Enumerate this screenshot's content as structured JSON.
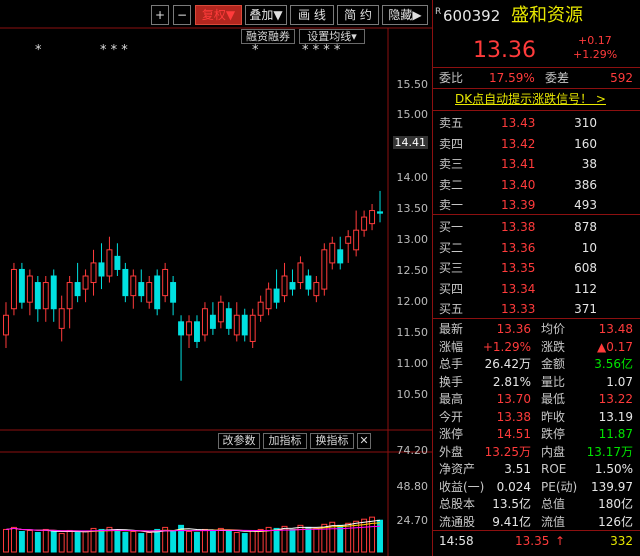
{
  "toolbar": {
    "plus": "+",
    "minus": "−",
    "fuquan": "复权▼",
    "diejia": "叠加▼",
    "huaxian": "画 线",
    "jianyue": "简 约",
    "yincang": "隐藏▶"
  },
  "chart_tags": {
    "rzrq": "融资融券",
    "ma": "设置均线▾"
  },
  "price_axis": [
    "15.50",
    "15.00",
    "14.41",
    "14.00",
    "13.50",
    "13.00",
    "12.50",
    "12.00",
    "11.50",
    "11.00",
    "10.50"
  ],
  "indicator_bar": {
    "params": "改参数",
    "add": "加指标",
    "swap": "换指标",
    "close": "✕"
  },
  "vol_axis": [
    "74.20",
    "48.80",
    "24.70"
  ],
  "stars": [
    "*",
    "* * *",
    "*",
    "* * * *"
  ],
  "stock": {
    "code": "600392",
    "name": "盛和资源",
    "price": "13.36",
    "change": "+0.17",
    "pct": "+1.29%"
  },
  "weibi": {
    "label": "委比",
    "value": "17.59%",
    "wc_label": "委差",
    "wc_value": "592"
  },
  "banner": "DK点自动提示涨跌信号！ >",
  "asks": [
    {
      "label": "卖五",
      "price": "13.43",
      "vol": "310"
    },
    {
      "label": "卖四",
      "price": "13.42",
      "vol": "160"
    },
    {
      "label": "卖三",
      "price": "13.41",
      "vol": "38"
    },
    {
      "label": "卖二",
      "price": "13.40",
      "vol": "386"
    },
    {
      "label": "卖一",
      "price": "13.39",
      "vol": "493"
    }
  ],
  "bids": [
    {
      "label": "买一",
      "price": "13.38",
      "vol": "878"
    },
    {
      "label": "买二",
      "price": "13.36",
      "vol": "10"
    },
    {
      "label": "买三",
      "price": "13.35",
      "vol": "608"
    },
    {
      "label": "买四",
      "price": "13.34",
      "vol": "112"
    },
    {
      "label": "买五",
      "price": "13.33",
      "vol": "371"
    }
  ],
  "quote": [
    {
      "l1": "最新",
      "v1": "13.36",
      "c1": "red",
      "l2": "均价",
      "v2": "13.48",
      "c2": "red"
    },
    {
      "l1": "涨幅",
      "v1": "+1.29%",
      "c1": "red",
      "l2": "涨跌",
      "v2": "▲0.17",
      "c2": "red"
    },
    {
      "l1": "总手",
      "v1": "26.42万",
      "c1": "white",
      "l2": "金额",
      "v2": "3.56亿",
      "c2": "green"
    },
    {
      "l1": "换手",
      "v1": "2.81%",
      "c1": "white",
      "l2": "量比",
      "v2": "1.07",
      "c2": "white"
    },
    {
      "l1": "最高",
      "v1": "13.70",
      "c1": "red",
      "l2": "最低",
      "v2": "13.22",
      "c2": "red"
    },
    {
      "l1": "今开",
      "v1": "13.38",
      "c1": "red",
      "l2": "昨收",
      "v2": "13.19",
      "c2": "white"
    },
    {
      "l1": "涨停",
      "v1": "14.51",
      "c1": "red",
      "l2": "跌停",
      "v2": "11.87",
      "c2": "green"
    },
    {
      "l1": "外盘",
      "v1": "13.25万",
      "c1": "red",
      "l2": "内盘",
      "v2": "13.17万",
      "c2": "green"
    },
    {
      "l1": "净资产",
      "v1": "3.51",
      "c1": "white",
      "l2": "ROE",
      "v2": "1.50%",
      "c2": "white"
    },
    {
      "l1": "收益(一)",
      "v1": "0.024",
      "c1": "white",
      "l2": "PE(动)",
      "v2": "139.97",
      "c2": "white"
    },
    {
      "l1": "总股本",
      "v1": "13.5亿",
      "c1": "white",
      "l2": "总值",
      "v2": "180亿",
      "c2": "white"
    },
    {
      "l1": "流通股",
      "v1": "9.41亿",
      "c1": "white",
      "l2": "流值",
      "v2": "126亿",
      "c2": "white"
    }
  ],
  "tick": {
    "time": "14:58",
    "price": "13.35",
    "arrow": "↑",
    "vol": "332"
  },
  "colors": {
    "up": "#ff3b3b",
    "down": "#00e0e0",
    "ma5": "#ffffff",
    "ma10": "#ffd400",
    "ma20": "#ff00ff",
    "grid": "#8c1010"
  },
  "chart_data": {
    "type": "candlestick",
    "ylim": [
      10.2,
      15.7
    ],
    "candles": [
      {
        "o": 11.5,
        "c": 11.8,
        "h": 12.0,
        "l": 11.3
      },
      {
        "o": 11.9,
        "c": 12.5,
        "h": 12.6,
        "l": 11.8
      },
      {
        "o": 12.5,
        "c": 12.0,
        "h": 12.6,
        "l": 11.9
      },
      {
        "o": 12.0,
        "c": 12.4,
        "h": 12.5,
        "l": 11.8
      },
      {
        "o": 12.3,
        "c": 11.9,
        "h": 12.4,
        "l": 11.7
      },
      {
        "o": 11.9,
        "c": 12.3,
        "h": 12.4,
        "l": 11.7
      },
      {
        "o": 12.4,
        "c": 11.9,
        "h": 12.5,
        "l": 11.7
      },
      {
        "o": 11.6,
        "c": 11.9,
        "h": 12.1,
        "l": 11.4
      },
      {
        "o": 11.9,
        "c": 12.3,
        "h": 12.4,
        "l": 11.6
      },
      {
        "o": 12.3,
        "c": 12.1,
        "h": 12.6,
        "l": 12.0
      },
      {
        "o": 12.2,
        "c": 12.4,
        "h": 12.5,
        "l": 12.0
      },
      {
        "o": 12.3,
        "c": 12.6,
        "h": 12.8,
        "l": 12.1
      },
      {
        "o": 12.6,
        "c": 12.4,
        "h": 12.9,
        "l": 12.2
      },
      {
        "o": 12.4,
        "c": 12.8,
        "h": 13.0,
        "l": 12.3
      },
      {
        "o": 12.7,
        "c": 12.5,
        "h": 12.9,
        "l": 12.4
      },
      {
        "o": 12.5,
        "c": 12.1,
        "h": 12.6,
        "l": 12.0
      },
      {
        "o": 12.1,
        "c": 12.4,
        "h": 12.5,
        "l": 11.9
      },
      {
        "o": 12.3,
        "c": 12.1,
        "h": 12.5,
        "l": 12.0
      },
      {
        "o": 12.0,
        "c": 12.3,
        "h": 12.4,
        "l": 11.9
      },
      {
        "o": 12.4,
        "c": 11.9,
        "h": 12.5,
        "l": 11.8
      },
      {
        "o": 12.1,
        "c": 12.5,
        "h": 12.6,
        "l": 12.0
      },
      {
        "o": 12.3,
        "c": 12.0,
        "h": 12.4,
        "l": 11.8
      },
      {
        "o": 11.7,
        "c": 11.5,
        "h": 11.8,
        "l": 10.8
      },
      {
        "o": 11.5,
        "c": 11.7,
        "h": 11.8,
        "l": 11.3
      },
      {
        "o": 11.7,
        "c": 11.4,
        "h": 11.8,
        "l": 11.3
      },
      {
        "o": 11.5,
        "c": 11.9,
        "h": 12.0,
        "l": 11.4
      },
      {
        "o": 11.8,
        "c": 11.6,
        "h": 12.0,
        "l": 11.5
      },
      {
        "o": 11.7,
        "c": 12.0,
        "h": 12.1,
        "l": 11.6
      },
      {
        "o": 11.9,
        "c": 11.6,
        "h": 12.0,
        "l": 11.5
      },
      {
        "o": 11.5,
        "c": 11.8,
        "h": 12.0,
        "l": 11.4
      },
      {
        "o": 11.8,
        "c": 11.5,
        "h": 11.9,
        "l": 11.4
      },
      {
        "o": 11.4,
        "c": 11.8,
        "h": 11.9,
        "l": 11.3
      },
      {
        "o": 11.8,
        "c": 12.0,
        "h": 12.1,
        "l": 11.7
      },
      {
        "o": 11.9,
        "c": 12.2,
        "h": 12.3,
        "l": 11.8
      },
      {
        "o": 12.2,
        "c": 12.0,
        "h": 12.5,
        "l": 11.9
      },
      {
        "o": 12.1,
        "c": 12.4,
        "h": 12.6,
        "l": 12.0
      },
      {
        "o": 12.3,
        "c": 12.2,
        "h": 12.5,
        "l": 12.1
      },
      {
        "o": 12.3,
        "c": 12.6,
        "h": 12.7,
        "l": 12.2
      },
      {
        "o": 12.4,
        "c": 12.2,
        "h": 12.5,
        "l": 12.1
      },
      {
        "o": 12.1,
        "c": 12.3,
        "h": 12.4,
        "l": 12.0
      },
      {
        "o": 12.2,
        "c": 12.8,
        "h": 12.9,
        "l": 12.1
      },
      {
        "o": 12.6,
        "c": 12.9,
        "h": 13.0,
        "l": 12.5
      },
      {
        "o": 12.8,
        "c": 12.6,
        "h": 13.0,
        "l": 12.5
      },
      {
        "o": 12.9,
        "c": 13.0,
        "h": 13.1,
        "l": 12.6
      },
      {
        "o": 12.8,
        "c": 13.1,
        "h": 13.4,
        "l": 12.7
      },
      {
        "o": 13.1,
        "c": 13.3,
        "h": 13.4,
        "l": 13.0
      },
      {
        "o": 13.2,
        "c": 13.4,
        "h": 13.5,
        "l": 13.1
      },
      {
        "o": 13.38,
        "c": 13.36,
        "h": 13.7,
        "l": 13.22
      }
    ],
    "volume": [
      22,
      24,
      20,
      21,
      19,
      22,
      20,
      18,
      21,
      19,
      20,
      23,
      22,
      24,
      21,
      19,
      20,
      18,
      19,
      22,
      24,
      21,
      26,
      20,
      19,
      22,
      21,
      23,
      20,
      19,
      18,
      21,
      22,
      24,
      23,
      25,
      22,
      26,
      24,
      23,
      27,
      29,
      26,
      28,
      30,
      32,
      34,
      31
    ],
    "vlim": [
      0,
      80
    ]
  }
}
